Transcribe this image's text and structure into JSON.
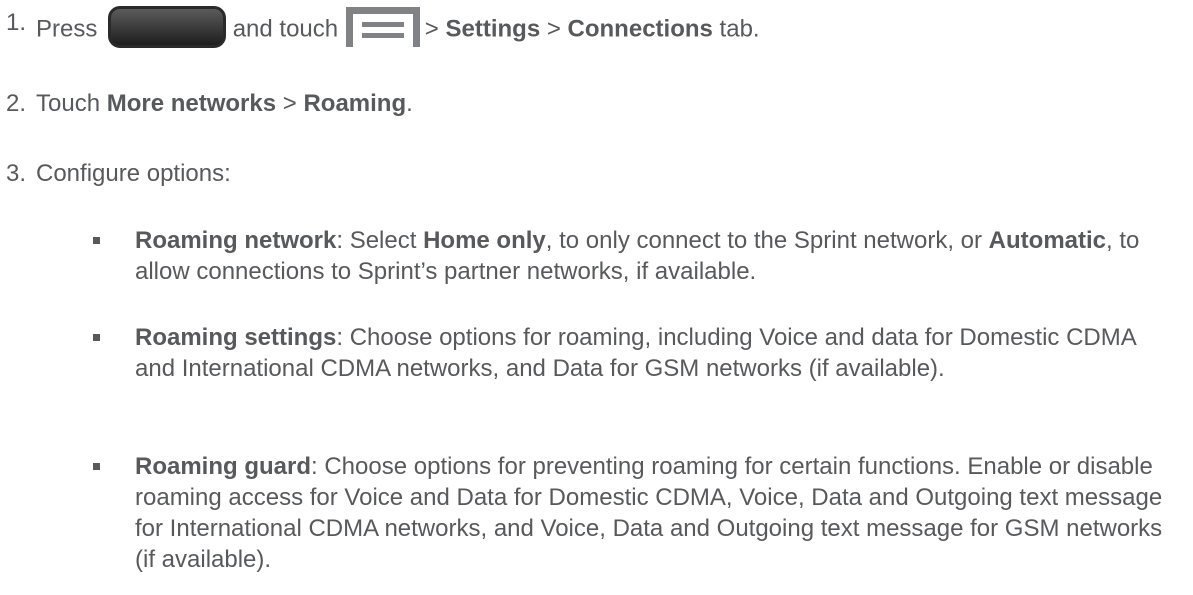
{
  "steps": [
    {
      "num": "1.",
      "s1_press": "Press",
      "s1_and": "and touch",
      "s1_gt1": ">",
      "s1_settings": "Settings",
      "s1_gt2": ">",
      "s1_connections": "Connections",
      "s1_tab": "tab."
    },
    {
      "num": "2.",
      "s2_touch": "Touch",
      "s2_more": "More networks",
      "s2_gt": ">",
      "s2_roaming": "Roaming",
      "s2_end": "."
    },
    {
      "num": "3.",
      "s3_text": "Configure options:"
    }
  ],
  "bullets": [
    {
      "term": "Roaming network",
      "p1": ": Select ",
      "home": "Home only",
      "p2": ", to only connect to the Sprint network, or ",
      "auto": "Automatic",
      "p3": ", to allow connections to Sprint’s partner networks, if available."
    },
    {
      "term": "Roaming settings",
      "body": ": Choose options for roaming, including Voice and data for Domestic CDMA and International CDMA networks, and Data for GSM networks (if available)."
    },
    {
      "term": "Roaming guard",
      "body": ": Choose options for preventing roaming for certain functions. Enable or disable roaming access for Voice and Data for Domestic CDMA, Voice, Data and Outgoing text message for International CDMA networks, and Voice, Data and Outgoing text message for GSM networks (if available)."
    }
  ],
  "icons": {
    "home_button": "home-key-icon",
    "menu_button": "menu-key-icon"
  },
  "colors": {
    "text": "#58595b",
    "home_key": "#333333",
    "menu_key": "#808285"
  }
}
